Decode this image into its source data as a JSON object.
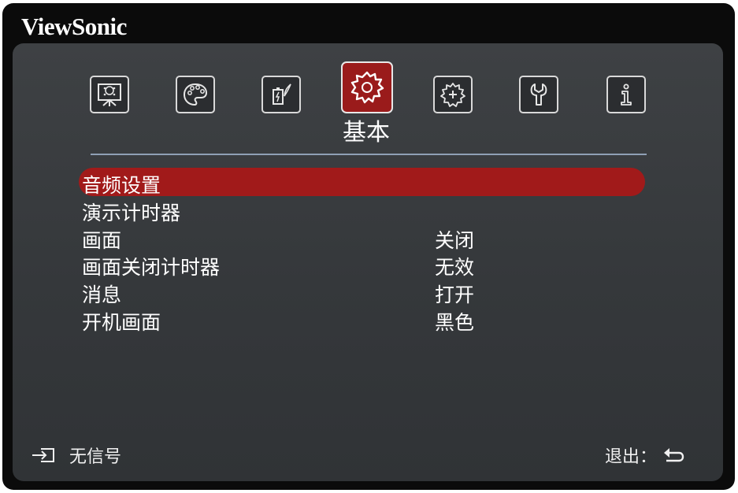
{
  "brand": "ViewSonic",
  "tabs": [
    {
      "icon": "display-icon",
      "active": false
    },
    {
      "icon": "palette-icon",
      "active": false
    },
    {
      "icon": "power-saving-icon",
      "active": false
    },
    {
      "icon": "gear-icon",
      "active": true
    },
    {
      "icon": "advanced-settings-icon",
      "active": false
    },
    {
      "icon": "wrench-icon",
      "active": false
    },
    {
      "icon": "info-icon",
      "active": false
    }
  ],
  "active_tab_label": "基本",
  "menu": {
    "items": [
      {
        "label": "音频设置",
        "value": "",
        "selected": true
      },
      {
        "label": "演示计时器",
        "value": ""
      },
      {
        "label": "画面",
        "value": "关闭"
      },
      {
        "label": "画面关闭计时器",
        "value": "无效"
      },
      {
        "label": "消息",
        "value": "打开"
      },
      {
        "label": "开机画面",
        "value": "黑色"
      }
    ]
  },
  "status": {
    "icon": "input-source-icon",
    "text": "无信号"
  },
  "exit": {
    "label": "退出：",
    "icon": "return-icon"
  },
  "colors": {
    "highlight": "#a11a1a",
    "active_tab": "#9a1b1b",
    "panel": "#3b3e41",
    "frame": "#0b0b0b"
  }
}
